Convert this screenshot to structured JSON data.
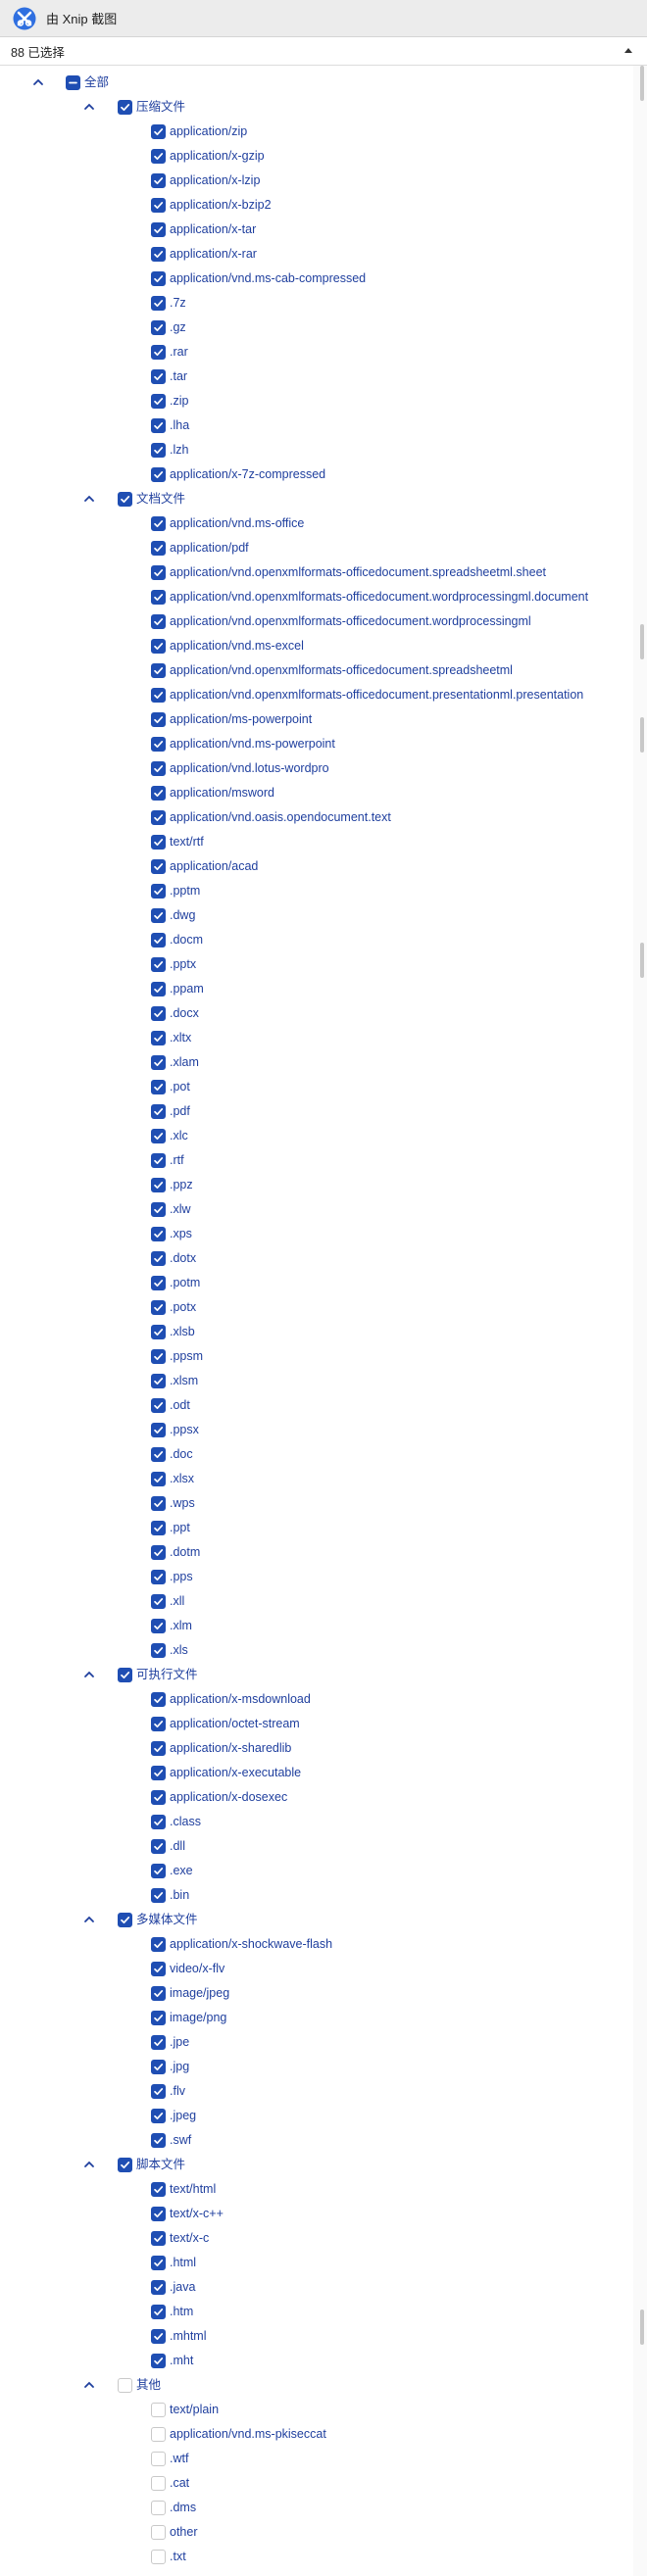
{
  "window": {
    "title": "由 Xnip 截图",
    "app_icon": "xnip-app-icon"
  },
  "selector": {
    "value": "88 已选择"
  },
  "colors": {
    "accent": "#1f4eb3",
    "label": "#1f3f9e"
  },
  "tree": {
    "root": {
      "label": "全部",
      "state": "mixed",
      "expanded": true
    },
    "groups": [
      {
        "label": "压缩文件",
        "state": "checked",
        "expanded": true,
        "items": [
          "application/zip",
          "application/x-gzip",
          "application/x-lzip",
          "application/x-bzip2",
          "application/x-tar",
          "application/x-rar",
          "application/vnd.ms-cab-compressed",
          ".7z",
          ".gz",
          ".rar",
          ".tar",
          ".zip",
          ".lha",
          ".lzh",
          "application/x-7z-compressed"
        ]
      },
      {
        "label": "文档文件",
        "state": "checked",
        "expanded": true,
        "items": [
          "application/vnd.ms-office",
          "application/pdf",
          "application/vnd.openxmlformats-officedocument.spreadsheetml.sheet",
          "application/vnd.openxmlformats-officedocument.wordprocessingml.document",
          "application/vnd.openxmlformats-officedocument.wordprocessingml",
          "application/vnd.ms-excel",
          "application/vnd.openxmlformats-officedocument.spreadsheetml",
          "application/vnd.openxmlformats-officedocument.presentationml.presentation",
          "application/ms-powerpoint",
          "application/vnd.ms-powerpoint",
          "application/vnd.lotus-wordpro",
          "application/msword",
          "application/vnd.oasis.opendocument.text",
          "text/rtf",
          "application/acad",
          ".pptm",
          ".dwg",
          ".docm",
          ".pptx",
          ".ppam",
          ".docx",
          ".xltx",
          ".xlam",
          ".pot",
          ".pdf",
          ".xlc",
          ".rtf",
          ".ppz",
          ".xlw",
          ".xps",
          ".dotx",
          ".potm",
          ".potx",
          ".xlsb",
          ".ppsm",
          ".xlsm",
          ".odt",
          ".ppsx",
          ".doc",
          ".xlsx",
          ".wps",
          ".ppt",
          ".dotm",
          ".pps",
          ".xll",
          ".xlm",
          ".xls"
        ]
      },
      {
        "label": "可执行文件",
        "state": "checked",
        "expanded": true,
        "items": [
          "application/x-msdownload",
          "application/octet-stream",
          "application/x-sharedlib",
          "application/x-executable",
          "application/x-dosexec",
          ".class",
          ".dll",
          ".exe",
          ".bin"
        ]
      },
      {
        "label": "多媒体文件",
        "state": "checked",
        "expanded": true,
        "items": [
          "application/x-shockwave-flash",
          "video/x-flv",
          "image/jpeg",
          "image/png",
          ".jpe",
          ".jpg",
          ".flv",
          ".jpeg",
          ".swf"
        ]
      },
      {
        "label": "脚本文件",
        "state": "checked",
        "expanded": true,
        "items": [
          "text/html",
          "text/x-c++",
          "text/x-c",
          ".html",
          ".java",
          ".htm",
          ".mhtml",
          ".mht"
        ]
      },
      {
        "label": "其他",
        "state": "unchecked",
        "expanded": true,
        "items": [
          "text/plain",
          "application/vnd.ms-pkiseccat",
          ".wtf",
          ".cat",
          ".dms",
          "other",
          ".txt"
        ]
      }
    ]
  }
}
